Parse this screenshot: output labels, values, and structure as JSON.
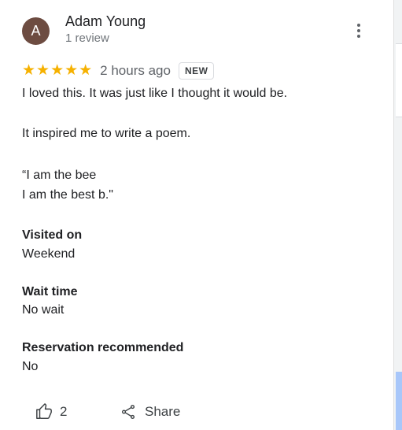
{
  "review": {
    "author": {
      "initial": "A",
      "name": "Adam Young",
      "review_count": "1 review",
      "avatar_color": "#6d4c41"
    },
    "rating": {
      "stars": 5,
      "star_text": "★★★★★",
      "star_color": "#f6b100"
    },
    "time_ago": "2 hours ago",
    "badge": "NEW",
    "text_lines": [
      "I loved this. It was just like I thought it would be.",
      "It inspired me to write a poem.",
      "“I am the bee",
      "I am the best b.\""
    ],
    "details": [
      {
        "label": "Visited on",
        "value": "Weekend"
      },
      {
        "label": "Wait time",
        "value": "No wait"
      },
      {
        "label": "Reservation recommended",
        "value": "No"
      }
    ],
    "actions": {
      "like_count": "2",
      "share_label": "Share",
      "like_icon": "thumbs-up-icon",
      "share_icon": "share-icon",
      "more_icon": "more-vert-icon"
    }
  }
}
